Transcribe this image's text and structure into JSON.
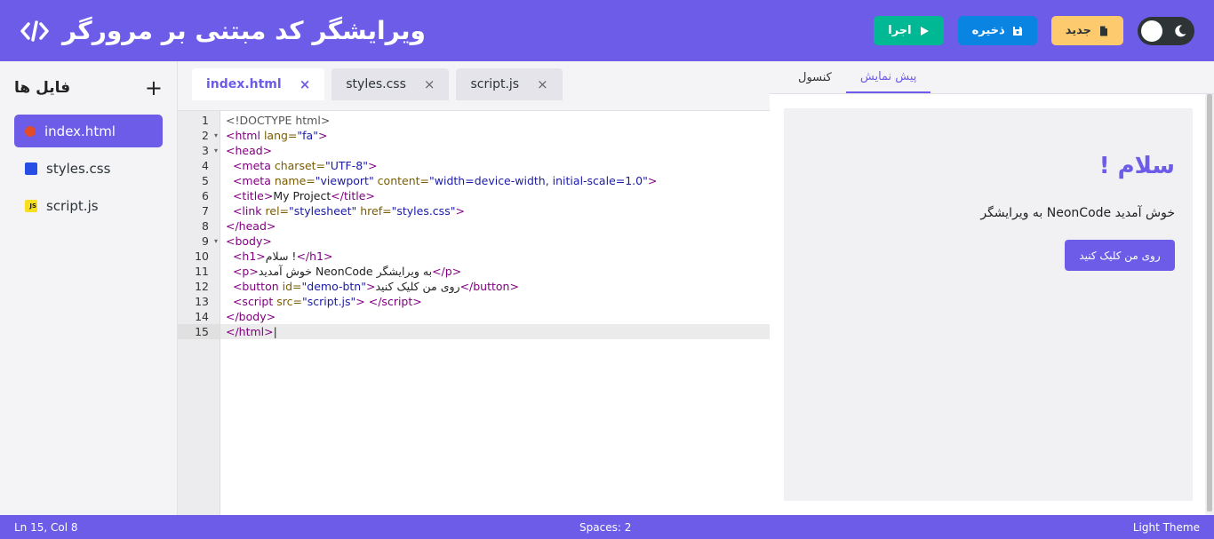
{
  "header": {
    "title": "ویرایشگر کد مبتنی بر مرورگر",
    "run_label": "اجرا",
    "save_label": "ذخیره",
    "new_label": "جدید"
  },
  "sidebar": {
    "title": "فایل ها",
    "add_label": "+",
    "files": [
      {
        "name": "index.html",
        "icon": "html5-icon"
      },
      {
        "name": "styles.css",
        "icon": "css3-icon"
      },
      {
        "name": "script.js",
        "icon": "js-icon"
      }
    ]
  },
  "tabs": [
    {
      "label": "index.html",
      "close": "×"
    },
    {
      "label": "styles.css",
      "close": "×"
    },
    {
      "label": "script.js",
      "close": "×"
    }
  ],
  "code": {
    "line_numbers": [
      "1",
      "2",
      "3",
      "4",
      "5",
      "6",
      "7",
      "8",
      "9",
      "10",
      "11",
      "12",
      "13",
      "14",
      "15"
    ]
  },
  "preview": {
    "tab_preview": "پیش نمایش",
    "tab_console": "کنسول",
    "heading": "سلام !",
    "paragraph": "خوش آمدید NeonCode به ویرایشگر",
    "button": "روی من کلیک کنید"
  },
  "status": {
    "position": "Ln 15, Col 8",
    "spaces": "Spaces: 2",
    "theme": "Light Theme"
  },
  "colors": {
    "accent": "#6c5ce7",
    "run": "#00b894",
    "save": "#0984e3",
    "new": "#fdcb6e"
  }
}
